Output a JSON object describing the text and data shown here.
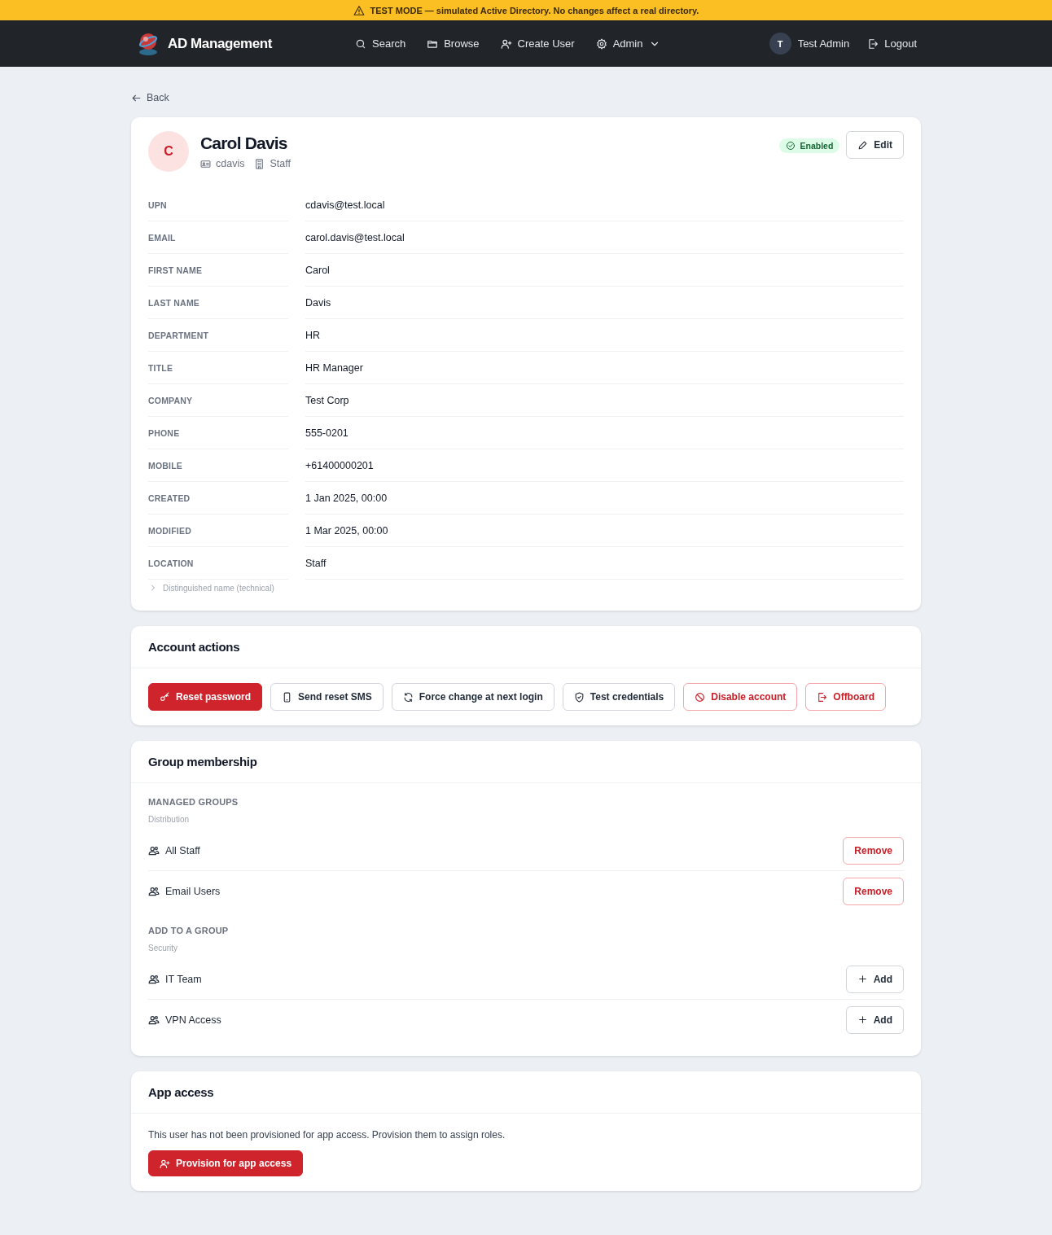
{
  "banner": {
    "text": "TEST MODE — simulated Active Directory. No changes affect a real directory."
  },
  "nav": {
    "brand": "AD Management",
    "items": [
      {
        "label": "Search",
        "dropdown": false
      },
      {
        "label": "Browse",
        "dropdown": false
      },
      {
        "label": "Create User",
        "dropdown": false
      },
      {
        "label": "Admin",
        "dropdown": true
      }
    ],
    "user": {
      "initial": "T",
      "name": "Test Admin"
    },
    "logout": "Logout"
  },
  "back": "Back",
  "profile": {
    "initial": "C",
    "name": "Carol Davis",
    "username": "cdavis",
    "ou": "Staff",
    "status": {
      "label": "Enabled",
      "enabled": true
    },
    "edit": "Edit",
    "fields": [
      {
        "label": "UPN",
        "value": "cdavis@test.local"
      },
      {
        "label": "EMAIL",
        "value": "carol.davis@test.local"
      },
      {
        "label": "FIRST NAME",
        "value": "Carol"
      },
      {
        "label": "LAST NAME",
        "value": "Davis"
      },
      {
        "label": "DEPARTMENT",
        "value": "HR"
      },
      {
        "label": "TITLE",
        "value": "HR Manager"
      },
      {
        "label": "COMPANY",
        "value": "Test Corp"
      },
      {
        "label": "PHONE",
        "value": "555-0201"
      },
      {
        "label": "MOBILE",
        "value": "+61400000201"
      },
      {
        "label": "CREATED",
        "value": "1 Jan 2025, 00:00"
      },
      {
        "label": "MODIFIED",
        "value": "1 Mar 2025, 00:00"
      },
      {
        "label": "LOCATION",
        "value": "Staff"
      }
    ],
    "dn": {
      "label": "Distinguished name (technical)",
      "expanded": false
    }
  },
  "account_actions": {
    "title": "Account actions",
    "buttons": [
      {
        "label": "Reset password",
        "kind": "primary"
      },
      {
        "label": "Send reset SMS",
        "kind": "outline"
      },
      {
        "label": "Force change at next login",
        "kind": "outline"
      },
      {
        "label": "Test credentials",
        "kind": "outline"
      },
      {
        "label": "Disable account",
        "kind": "danger"
      },
      {
        "label": "Offboard",
        "kind": "danger"
      }
    ]
  },
  "group_membership": {
    "title": "Group membership",
    "sections": [
      {
        "heading": "MANAGED GROUPS",
        "category": "Distribution",
        "groups": [
          {
            "name": "All Staff",
            "action": "Remove",
            "kind": "remove"
          },
          {
            "name": "Email Users",
            "action": "Remove",
            "kind": "remove"
          }
        ]
      },
      {
        "heading": "ADD TO A GROUP",
        "category": "Security",
        "groups": [
          {
            "name": "IT Team",
            "action": "Add",
            "kind": "add"
          },
          {
            "name": "VPN Access",
            "action": "Add",
            "kind": "add"
          }
        ]
      }
    ]
  },
  "app_access": {
    "title": "App access",
    "message": "This user has not been provisioned for app access. Provision them to assign roles.",
    "button": "Provision for app access"
  }
}
